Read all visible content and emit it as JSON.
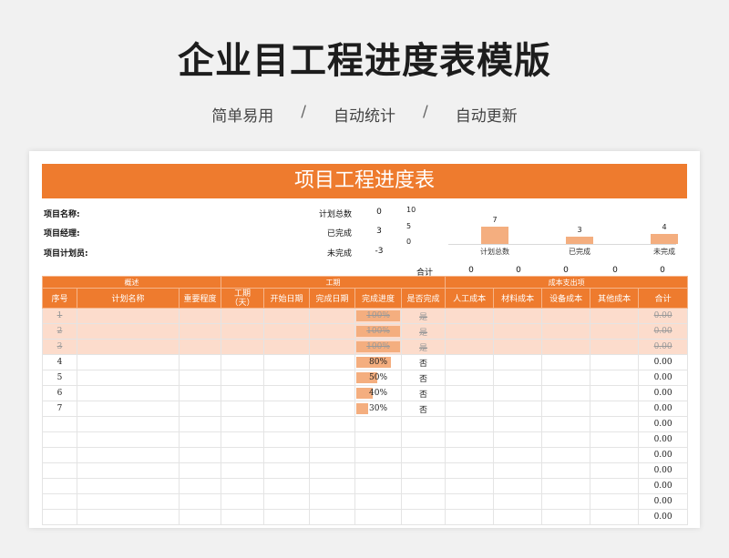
{
  "page": {
    "title": "企业目工程进度表模版",
    "tags": [
      "简单易用",
      "自动统计",
      "自动更新"
    ],
    "separator": "/"
  },
  "sheet": {
    "banner": "项目工程进度表",
    "info": {
      "project_name": "项目名称:",
      "project_manager": "项目经理:",
      "planner": "项目计划员:"
    },
    "stats": [
      {
        "label": "计划总数",
        "value": "0"
      },
      {
        "label": "已完成",
        "value": "3"
      },
      {
        "label": "未完成",
        "value": "-3"
      }
    ],
    "totals": {
      "label": "合计",
      "values": [
        "0",
        "0",
        "0",
        "0",
        "0"
      ]
    },
    "group_headers": {
      "overview": "概述",
      "period": "工期",
      "cost": "成本支出项"
    },
    "columns": [
      "序号",
      "计划名称",
      "重要程度",
      "工期\n（天）",
      "开始日期",
      "完成日期",
      "完成进度",
      "是否完成",
      "人工成本",
      "材料成本",
      "设备成本",
      "其他成本",
      "合计"
    ],
    "rows": [
      {
        "no": "1",
        "progress": "100%",
        "progress_value": 1.0,
        "done": "是",
        "total": "0.00",
        "completed": true
      },
      {
        "no": "2",
        "progress": "100%",
        "progress_value": 1.0,
        "done": "是",
        "total": "0.00",
        "completed": true
      },
      {
        "no": "3",
        "progress": "100%",
        "progress_value": 1.0,
        "done": "是",
        "total": "0.00",
        "completed": true
      },
      {
        "no": "4",
        "progress": "80%",
        "progress_value": 0.8,
        "done": "否",
        "total": "0.00",
        "completed": false
      },
      {
        "no": "5",
        "progress": "50%",
        "progress_value": 0.5,
        "done": "否",
        "total": "0.00",
        "completed": false
      },
      {
        "no": "6",
        "progress": "40%",
        "progress_value": 0.4,
        "done": "否",
        "total": "0.00",
        "completed": false
      },
      {
        "no": "7",
        "progress": "30%",
        "progress_value": 0.3,
        "done": "否",
        "total": "0.00",
        "completed": false
      },
      {
        "no": "",
        "progress": "",
        "progress_value": 0,
        "done": "",
        "total": "0.00",
        "completed": false
      },
      {
        "no": "",
        "progress": "",
        "progress_value": 0,
        "done": "",
        "total": "0.00",
        "completed": false
      },
      {
        "no": "",
        "progress": "",
        "progress_value": 0,
        "done": "",
        "total": "0.00",
        "completed": false
      },
      {
        "no": "",
        "progress": "",
        "progress_value": 0,
        "done": "",
        "total": "0.00",
        "completed": false
      },
      {
        "no": "",
        "progress": "",
        "progress_value": 0,
        "done": "",
        "total": "0.00",
        "completed": false
      },
      {
        "no": "",
        "progress": "",
        "progress_value": 0,
        "done": "",
        "total": "0.00",
        "completed": false
      },
      {
        "no": "",
        "progress": "",
        "progress_value": 0,
        "done": "",
        "total": "0.00",
        "completed": false
      }
    ],
    "accent_color": "#ee7b2e",
    "bar_color": "#f4ae7f"
  },
  "chart_data": {
    "type": "bar",
    "categories": [
      "计划总数",
      "已完成",
      "未完成"
    ],
    "values": [
      7,
      3,
      4
    ],
    "yticks": [
      "10",
      "5",
      "0"
    ],
    "ylim": [
      0,
      10
    ]
  }
}
